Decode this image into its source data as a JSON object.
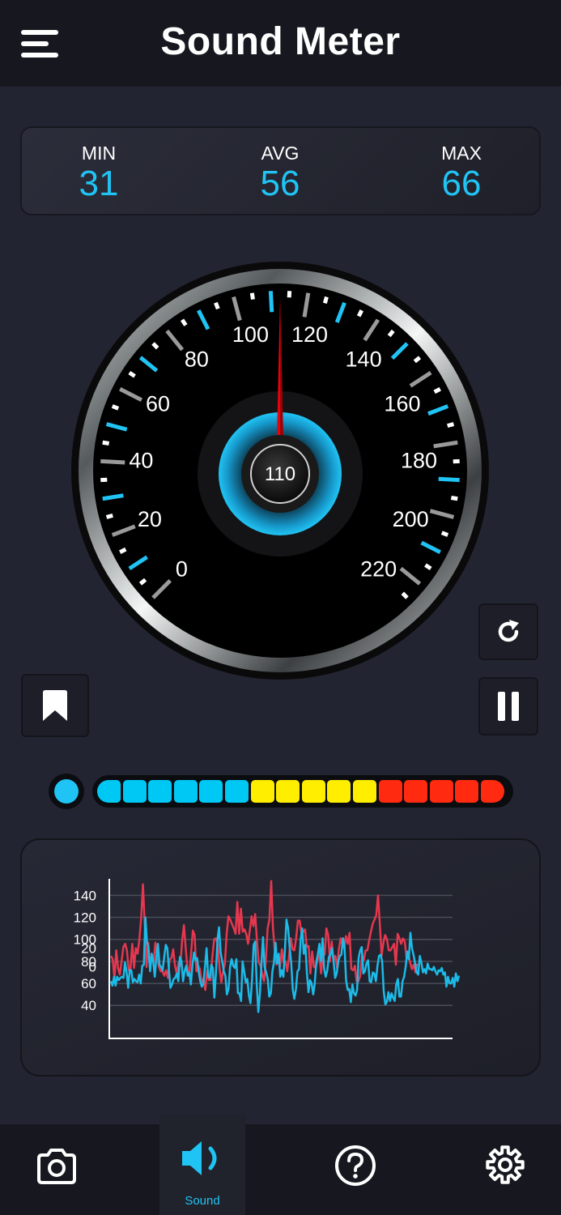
{
  "header": {
    "title": "Sound Meter",
    "menu_icon": "hamburger-icon"
  },
  "stats": [
    {
      "label": "MIN",
      "value": "31"
    },
    {
      "label": "AVG",
      "value": "56"
    },
    {
      "label": "MAX",
      "value": "66"
    }
  ],
  "gauge": {
    "ticks": [
      "0",
      "20",
      "40",
      "60",
      "80",
      "100",
      "120",
      "140",
      "160",
      "180",
      "200",
      "220"
    ],
    "reading": "110",
    "needle_value": 110,
    "range": [
      0,
      220
    ],
    "accent": "#20c4f4",
    "needle_color": "#e8000a"
  },
  "controls": {
    "reset_icon": "refresh-icon",
    "bookmark_icon": "bookmark-icon",
    "pause_icon": "pause-icon"
  },
  "level_meter": {
    "segments": [
      "#00c8f5",
      "#00c8f5",
      "#00c8f5",
      "#00c8f5",
      "#00c8f5",
      "#00c8f5",
      "#ffee00",
      "#ffee00",
      "#ffee00",
      "#ffee00",
      "#ffee00",
      "#ff2a10",
      "#ff2a10",
      "#ff2a10",
      "#ff2a10",
      "#ff2a10"
    ]
  },
  "chart_data": {
    "type": "line",
    "ytick_labels": [
      "140",
      "120",
      "100",
      "20",
      "80",
      "0",
      "60",
      "40"
    ],
    "gridlines": [
      140,
      120,
      100,
      80,
      60,
      40
    ],
    "ylim": [
      10,
      155
    ],
    "series": [
      {
        "color": "#e5384f",
        "values": [
          85,
          82,
          64,
          90,
          74,
          68,
          80,
          93,
          96,
          90,
          72,
          74,
          96,
          74,
          92,
          87,
          100,
          120,
          150,
          113,
          75,
          97,
          75,
          82,
          80,
          97,
          84,
          75,
          71,
          71,
          67,
          72,
          65,
          82,
          83,
          91,
          76,
          69,
          79,
          76,
          99,
          113,
          92,
          73,
          68,
          87,
          108,
          104,
          71,
          76,
          73,
          61,
          64,
          54,
          71,
          63,
          63,
          85,
          100,
          101,
          96,
          74,
          61,
          71,
          78,
          105,
          121,
          118,
          114,
          110,
          105,
          134,
          105,
          128,
          107,
          109,
          105,
          96,
          108,
          121,
          112,
          123,
          99,
          79,
          76,
          68,
          62,
          81,
          110,
          118,
          153,
          110,
          90,
          77,
          82,
          75,
          91,
          79,
          80,
          71,
          84,
          101,
          91,
          90,
          101,
          117,
          117,
          105,
          107,
          109,
          93,
          94,
          69,
          89,
          75,
          74,
          81,
          88,
          69,
          88,
          86,
          110,
          104,
          80,
          98,
          81,
          85,
          74,
          91,
          101,
          95,
          92,
          103,
          96,
          106,
          73,
          72,
          76,
          62,
          62,
          67,
          85,
          81,
          90,
          90,
          99,
          107,
          114,
          118,
          122,
          140,
          114,
          85,
          97,
          104,
          100,
          90,
          90,
          93,
          96,
          77,
          105,
          101,
          96,
          101,
          98,
          83,
          87,
          79,
          73,
          77,
          70,
          78
        ]
      },
      {
        "color": "#1cbbe8",
        "values": [
          62,
          58,
          66,
          58,
          66,
          63,
          65,
          66,
          65,
          79,
          70,
          56,
          72,
          72,
          61,
          64,
          62,
          61,
          68,
          60,
          76,
          77,
          120,
          98,
          91,
          71,
          87,
          80,
          66,
          84,
          96,
          77,
          75,
          72,
          84,
          95,
          92,
          72,
          56,
          59,
          64,
          65,
          69,
          62,
          84,
          80,
          62,
          71,
          76,
          67,
          70,
          59,
          77,
          88,
          81,
          83,
          70,
          62,
          57,
          60,
          75,
          92,
          66,
          65,
          77,
          74,
          47,
          70,
          100,
          111,
          88,
          80,
          71,
          67,
          50,
          55,
          75,
          82,
          76,
          74,
          82,
          51,
          51,
          44,
          80,
          71,
          61,
          64,
          49,
          42,
          63,
          95,
          98,
          60,
          34,
          50,
          77,
          102,
          75,
          70,
          64,
          48,
          51,
          71,
          79,
          97,
          78,
          87,
          66,
          72,
          66,
          91,
          118,
          110,
          93,
          79,
          54,
          46,
          55,
          71,
          73,
          100,
          110,
          87,
          95,
          70,
          52,
          63,
          60,
          50,
          60,
          79,
          87,
          96,
          80,
          101,
          73,
          66,
          72,
          84,
          86,
          92,
          81,
          65,
          69,
          80,
          85,
          86,
          101,
          93,
          63,
          54,
          55,
          43,
          59,
          51,
          49,
          54,
          83,
          90,
          93,
          69,
          71,
          78,
          81,
          62,
          61,
          70,
          69,
          62,
          76,
          85,
          86,
          80,
          53,
          41,
          43,
          52,
          44,
          51,
          47,
          44,
          59,
          64,
          48,
          48,
          62,
          66,
          75,
          89,
          82,
          106,
          92,
          86,
          78,
          70,
          68,
          85,
          79,
          70,
          73,
          69,
          78,
          73,
          73,
          72,
          75,
          71,
          68,
          72,
          71,
          74,
          68,
          70,
          57,
          66,
          60,
          60,
          65,
          57,
          69,
          62,
          67
        ]
      }
    ]
  },
  "bottom_nav": [
    {
      "icon": "camera-icon",
      "label": ""
    },
    {
      "icon": "speaker-icon",
      "label": "Sound"
    },
    {
      "icon": "help-icon",
      "label": ""
    },
    {
      "icon": "settings-icon",
      "label": ""
    }
  ]
}
